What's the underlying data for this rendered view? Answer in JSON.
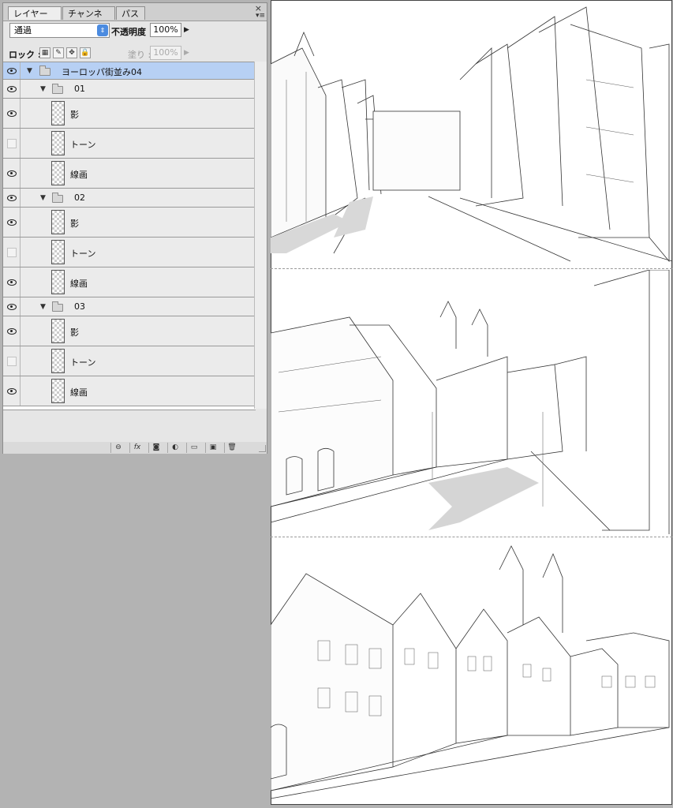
{
  "tabs": [
    {
      "label": "レイヤー",
      "active": true,
      "close": "×"
    },
    {
      "label": "チャンネル",
      "active": false
    },
    {
      "label": "パス",
      "active": false
    }
  ],
  "window": {
    "close": "×",
    "menu": "▾≡"
  },
  "blend": {
    "mode": "通過",
    "opacity_label": "不透明度 :",
    "opacity": "100%"
  },
  "lock": {
    "label": "ロック :",
    "fill_label": "塗り :",
    "fill": "100%"
  },
  "layers": [
    {
      "name": "ヨーロッパ街並み04",
      "type": "group",
      "visible": true,
      "selected": true,
      "level": 0
    },
    {
      "name": "01",
      "type": "group",
      "visible": true,
      "level": 1
    },
    {
      "name": "影",
      "type": "layer",
      "visible": true,
      "level": 2
    },
    {
      "name": "トーン",
      "type": "layer",
      "visible": false,
      "level": 2
    },
    {
      "name": "線画",
      "type": "layer",
      "visible": true,
      "level": 2
    },
    {
      "name": "02",
      "type": "group",
      "visible": true,
      "level": 1
    },
    {
      "name": "影",
      "type": "layer",
      "visible": true,
      "level": 2
    },
    {
      "name": "トーン",
      "type": "layer",
      "visible": false,
      "level": 2
    },
    {
      "name": "線画",
      "type": "layer",
      "visible": true,
      "level": 2
    },
    {
      "name": "03",
      "type": "group",
      "visible": true,
      "level": 1
    },
    {
      "name": "影",
      "type": "layer",
      "visible": true,
      "level": 2
    },
    {
      "name": "トーン",
      "type": "layer",
      "visible": false,
      "level": 2
    },
    {
      "name": "線画",
      "type": "layer",
      "visible": true,
      "level": 2
    }
  ],
  "bottom_icons": [
    "link-icon",
    "fx-icon",
    "mask-icon",
    "adjustment-icon",
    "new-group-icon",
    "new-layer-icon",
    "trash-icon"
  ],
  "bottom_labels": {
    "fx": "fx"
  },
  "colors": {
    "selection": "#b7d0f4",
    "select_arrow": "#4b8be0"
  }
}
